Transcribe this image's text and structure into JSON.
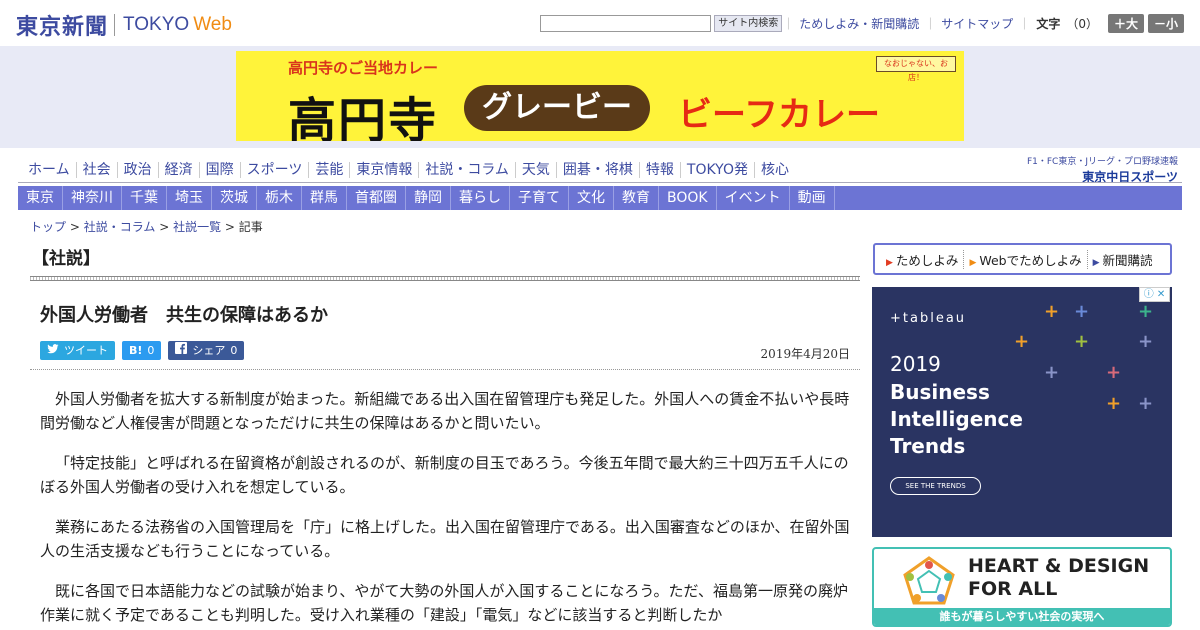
{
  "header": {
    "logo_jp": "東京新聞",
    "logo_tokyo": "TOKYO",
    "logo_web": "Web",
    "search_button": "サイト内検索",
    "links": [
      "ためしよみ・新聞購読",
      "サイトマップ"
    ],
    "font_label": "文字",
    "font_value": "（0）",
    "font_larger": "＋大",
    "font_smaller": "－小"
  },
  "banner": {
    "small_text": "高円寺のご当地カレー",
    "big_text": "高円寺",
    "pill_text": "グレービー",
    "red_text": "ビーフカレー",
    "badge_text": "なおじゃない、お店！"
  },
  "nav_primary": [
    "ホーム",
    "社会",
    "政治",
    "経済",
    "国際",
    "スポーツ",
    "芸能",
    "東京情報",
    "社説・コラム",
    "天気",
    "囲碁・将棋",
    "特報",
    "TOKYO発",
    "核心"
  ],
  "nav_secondary": [
    "東京",
    "神奈川",
    "千葉",
    "埼玉",
    "茨城",
    "栃木",
    "群馬",
    "首都圏",
    "静岡",
    "暮らし",
    "子育て",
    "文化",
    "教育",
    "BOOK",
    "イベント",
    "動画"
  ],
  "sports_link": {
    "top": "F1・FC東京・Jリーグ・プロ野球速報",
    "logo": "東京中日スポーツ"
  },
  "breadcrumb": [
    "トップ",
    "社説・コラム",
    "社説一覧",
    "記事"
  ],
  "article": {
    "section": "【社説】",
    "title": "外国人労働者　共生の保障はあるか",
    "share": {
      "tweet": "ツイート",
      "hatena_glyph": "B!",
      "hatena_count": "0",
      "facebook_label": "シェア",
      "facebook_count": "0"
    },
    "date": "2019年4月20日",
    "paragraphs": [
      "外国人労働者を拡大する新制度が始まった。新組織である出入国在留管理庁も発足した。外国人への賃金不払いや長時間労働など人権侵害が問題となっただけに共生の保障はあるかと問いたい。",
      "「特定技能」と呼ばれる在留資格が創設されるのが、新制度の目玉であろう。今後五年間で最大約三十四万五千人にのぼる外国人労働者の受け入れを想定している。",
      "業務にあたる法務省の入国管理局を「庁」に格上げした。出入国在留管理庁である。出入国審査などのほか、在留外国人の生活支援なども行うことになっている。",
      "既に各国で日本語能力などの試験が始まり、やがて大勢の外国人が入国することになろう。ただ、福島第一原発の廃炉作業に就く予定であることも判明した。受け入れ業種の「建設」「電気」などに該当すると判断したか"
    ]
  },
  "sidebar": {
    "links": [
      "ためしよみ",
      "Webでためしよみ",
      "新聞購読"
    ],
    "ad_tableau": {
      "logo": "+tableau",
      "year": "2019",
      "headline": [
        "Business",
        "Intelligence",
        "Trends"
      ],
      "cta": "SEE THE TRENDS"
    },
    "ad_heart": {
      "title_line1": "HEART & DESIGN",
      "title_line2": "FOR ALL",
      "bar": "誰もが暮らしやすい社会の実現へ"
    }
  },
  "colors": {
    "brand_blue": "#3d4ba0",
    "brand_orange": "#f08c14",
    "nav_purple": "#6c74d4",
    "twitter": "#2ca7e0",
    "facebook": "#3b5998",
    "tableau_bg": "#2a3462",
    "heart_teal": "#43c0b4"
  }
}
